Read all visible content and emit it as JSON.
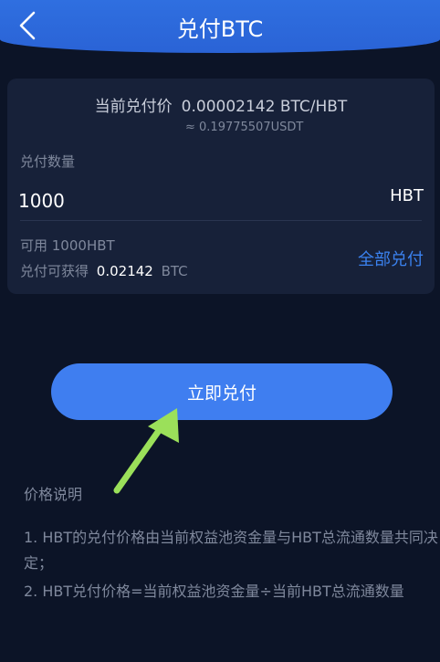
{
  "header": {
    "title": "兑付BTC"
  },
  "card": {
    "price_label": "当前兑付价",
    "price_value": "0.00002142 BTC/HBT",
    "usdt_value": "≈ 0.19775507USDT",
    "quantity_label": "兑付数量",
    "quantity_value": "1000",
    "quantity_unit": "HBT",
    "available_text": "可用 1000HBT",
    "receivable_label": "兑付可获得",
    "receivable_value": "0.02142",
    "receivable_unit": "BTC",
    "redeem_all_label": "全部兑付"
  },
  "action": {
    "redeem_now_label": "立即兑付"
  },
  "notes": {
    "title": "价格说明",
    "items": [
      "1. HBT的兑付价格由当前权益池资金量与HBT总流通数量共同决定；",
      "2. HBT兑付价格=当前权益池资金量÷当前HBT总流通数量"
    ]
  },
  "colors": {
    "background": "#0c1427",
    "header": "#2f6fe0",
    "card": "#172139",
    "accent": "#3b82f0",
    "arrow": "#9be05a"
  },
  "icons": {
    "back": "chevron-left-icon",
    "pointer": "arrow-pointer-icon"
  }
}
